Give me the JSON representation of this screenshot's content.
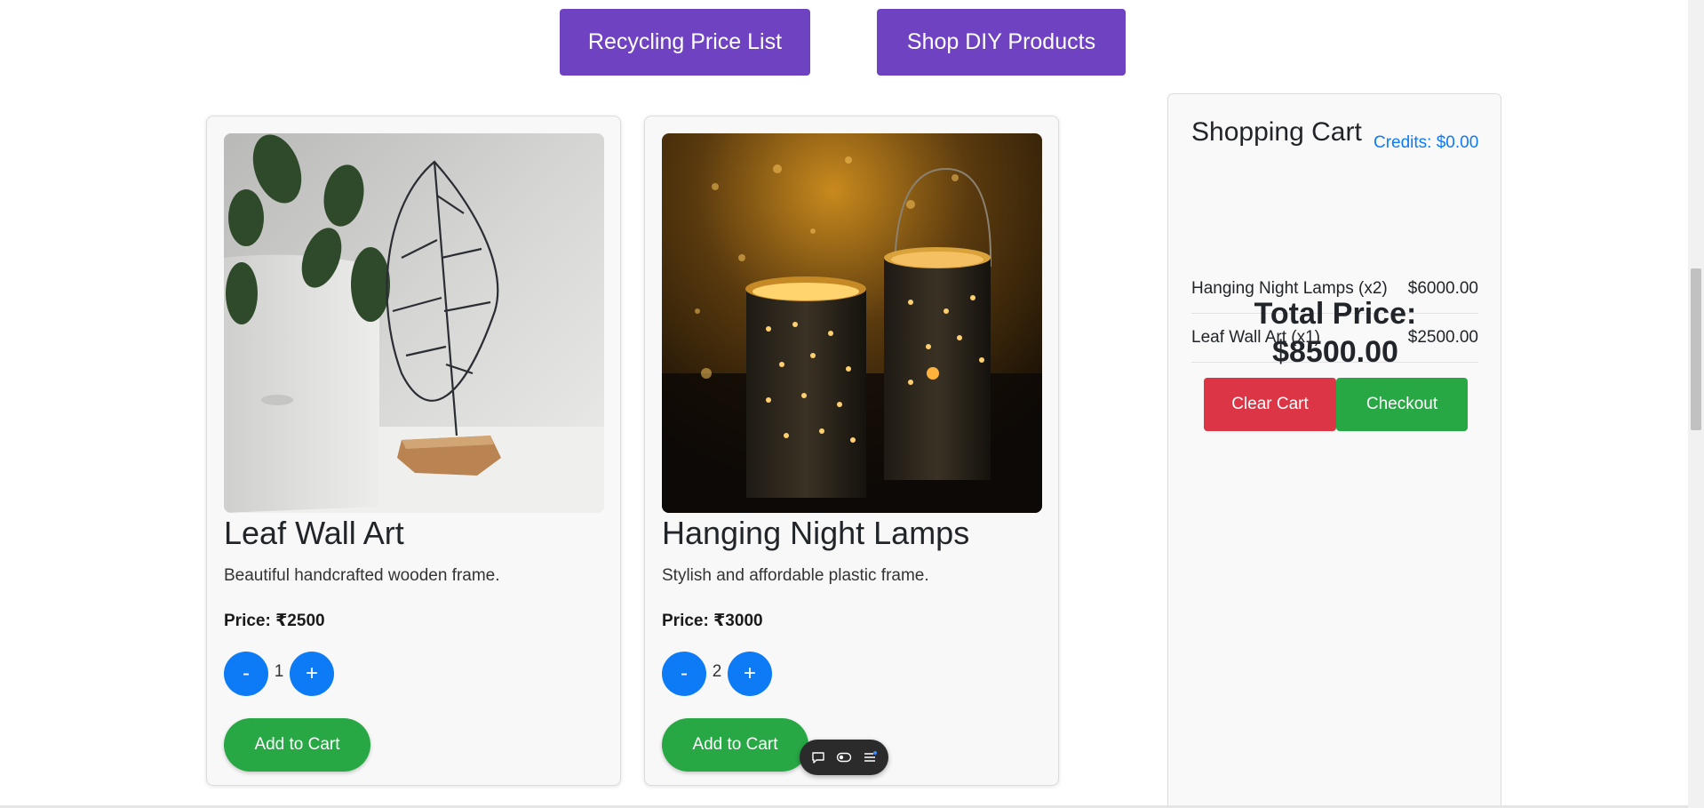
{
  "nav": {
    "recycling_label": "Recycling Price List",
    "shop_label": "Shop DIY Products"
  },
  "products": [
    {
      "title": "Leaf Wall Art",
      "description": "Beautiful handcrafted wooden frame.",
      "price": "Price: ₹2500",
      "quantity": "1",
      "minus_label": "-",
      "plus_label": "+",
      "add_label": "Add to Cart",
      "image": "leaf-wire-sculpture-image"
    },
    {
      "title": "Hanging Night Lamps",
      "description": "Stylish and affordable plastic frame.",
      "price": "Price: ₹3000",
      "quantity": "2",
      "minus_label": "-",
      "plus_label": "+",
      "add_label": "Add to Cart",
      "image": "tin-can-lanterns-image"
    }
  ],
  "cart": {
    "title": "Shopping Cart",
    "credits": "Credits: $0.00",
    "items": [
      {
        "name": "Hanging Night Lamps (x2)",
        "amount": "$6000.00"
      },
      {
        "name": "Leaf Wall Art (x1)",
        "amount": "$2500.00"
      }
    ],
    "total_label": "Total Price:",
    "total_value": "$8500.00",
    "clear_label": "Clear Cart",
    "checkout_label": "Checkout"
  },
  "colors": {
    "purple": "#6f42c1",
    "blue": "#0d7bf5",
    "green": "#28a745",
    "red": "#dc3545"
  },
  "floating_toolbar": {
    "icons": [
      "chat-bubble-icon",
      "toggle-icon",
      "menu-icon"
    ]
  }
}
